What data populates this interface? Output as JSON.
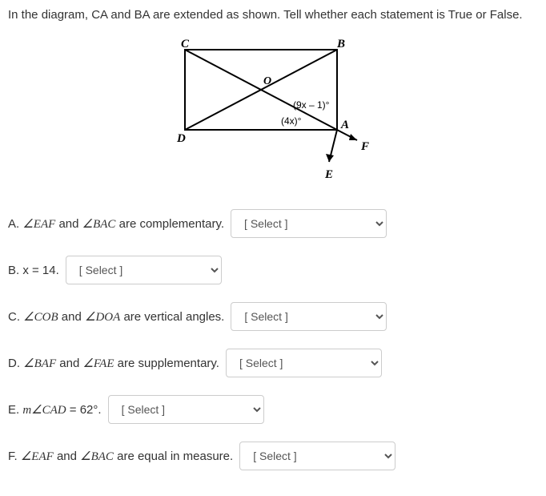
{
  "question": "In the diagram, CA and BA are extended as shown. Tell whether each statement is True or False.",
  "diagram": {
    "labels": {
      "C": "C",
      "B": "B",
      "D": "D",
      "A": "A",
      "O": "O",
      "E": "E",
      "F": "F",
      "angle1": "(9x – 1)°",
      "angle2": "(4x)°"
    }
  },
  "items": {
    "A": {
      "prefix": "A. ",
      "angle1": "∠EAF",
      "mid1": " and ",
      "angle2": "∠BAC",
      "suffix": " are complementary.",
      "select": "[ Select ]"
    },
    "B": {
      "prefix": "B. x = 14.",
      "select": "[ Select ]"
    },
    "C": {
      "prefix": "C. ",
      "angle1": "∠COB",
      "mid1": " and ",
      "angle2": "∠DOA",
      "suffix": " are vertical angles.",
      "select": "[ Select ]"
    },
    "D": {
      "prefix": "D. ",
      "angle1": "∠BAF",
      "mid1": " and ",
      "angle2": "∠FAE",
      "suffix": " are supplementary.",
      "select": "[ Select ]"
    },
    "E": {
      "prefix": "E. ",
      "math": "m∠CAD",
      "suffix": " = 62°.",
      "select": "[ Select ]"
    },
    "F": {
      "prefix": "F. ",
      "angle1": "∠EAF",
      "mid1": " and ",
      "angle2": "∠BAC",
      "suffix": " are equal in measure.",
      "select": "[ Select ]"
    }
  }
}
